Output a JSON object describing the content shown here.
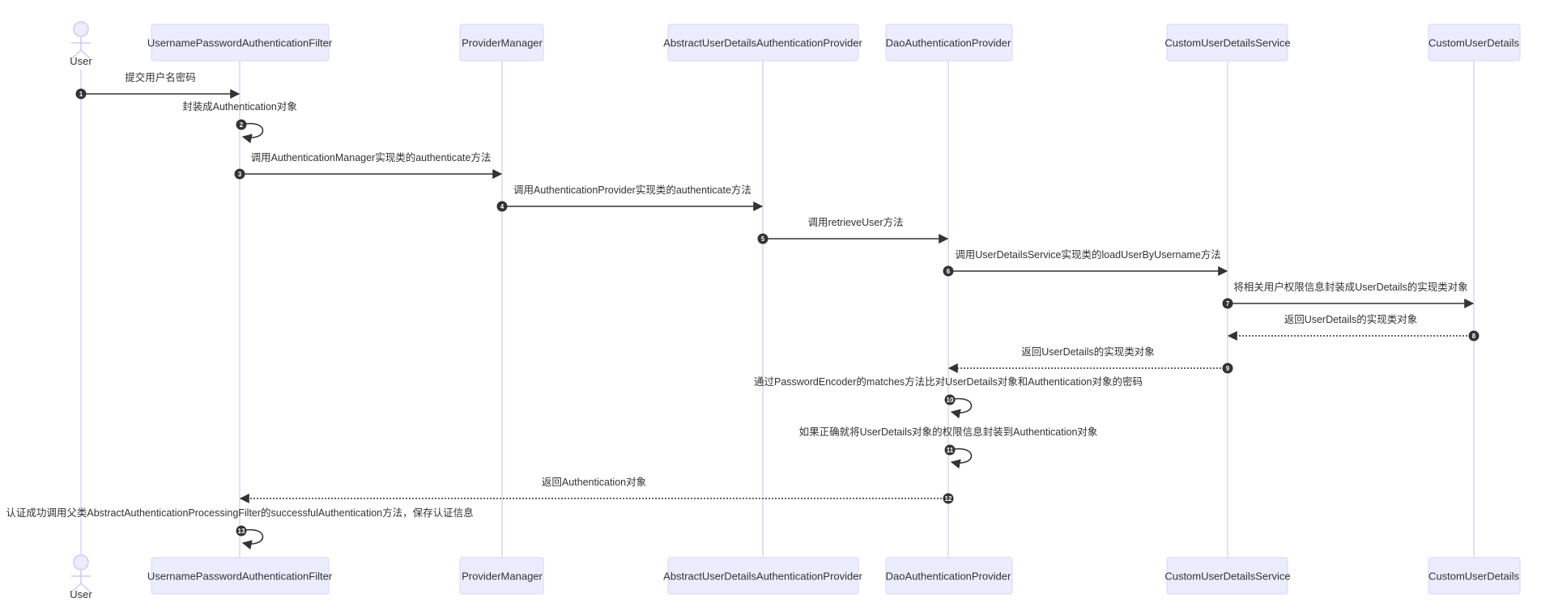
{
  "diagram": {
    "type": "sequence",
    "colors": {
      "participant_fill": "#ECECFF",
      "participant_border": "#D9D6F5",
      "line": "#333333",
      "text": "#333333"
    },
    "participants": [
      {
        "id": "User",
        "label": "User",
        "kind": "actor"
      },
      {
        "id": "UPAF",
        "label": "UsernamePasswordAuthenticationFilter",
        "kind": "participant"
      },
      {
        "id": "PM",
        "label": "ProviderManager",
        "kind": "participant"
      },
      {
        "id": "AUDAP",
        "label": "AbstractUserDetailsAuthenticationProvider",
        "kind": "participant"
      },
      {
        "id": "DAP",
        "label": "DaoAuthenticationProvider",
        "kind": "participant"
      },
      {
        "id": "CUDS",
        "label": "CustomUserDetailsService",
        "kind": "participant"
      },
      {
        "id": "CUD",
        "label": "CustomUserDetails",
        "kind": "participant"
      }
    ],
    "messages": [
      {
        "n": "1",
        "from": "User",
        "to": "UPAF",
        "label": "提交用户名密码",
        "style": "solid"
      },
      {
        "n": "2",
        "from": "UPAF",
        "to": "UPAF",
        "label": "封装成Authentication对象",
        "style": "solid"
      },
      {
        "n": "3",
        "from": "UPAF",
        "to": "PM",
        "label": "调用AuthenticationManager实现类的authenticate方法",
        "style": "solid"
      },
      {
        "n": "4",
        "from": "PM",
        "to": "AUDAP",
        "label": "调用AuthenticationProvider实现类的authenticate方法",
        "style": "solid"
      },
      {
        "n": "5",
        "from": "AUDAP",
        "to": "DAP",
        "label": "调用retrieveUser方法",
        "style": "solid"
      },
      {
        "n": "6",
        "from": "DAP",
        "to": "CUDS",
        "label": "调用UserDetailsService实现类的loadUserByUsername方法",
        "style": "solid"
      },
      {
        "n": "7",
        "from": "CUDS",
        "to": "CUD",
        "label": "将相关用户权限信息封装成UserDetails的实现类对象",
        "style": "solid"
      },
      {
        "n": "8",
        "from": "CUD",
        "to": "CUDS",
        "label": "返回UserDetails的实现类对象",
        "style": "dotted"
      },
      {
        "n": "9",
        "from": "CUDS",
        "to": "DAP",
        "label": "返回UserDetails的实现类对象",
        "style": "dotted"
      },
      {
        "n": "10",
        "from": "DAP",
        "to": "DAP",
        "label": "通过PasswordEncoder的matches方法比对UserDetails对象和Authentication对象的密码",
        "style": "solid"
      },
      {
        "n": "11",
        "from": "DAP",
        "to": "DAP",
        "label": "如果正确就将UserDetails对象的权限信息封装到Authentication对象",
        "style": "solid"
      },
      {
        "n": "12",
        "from": "DAP",
        "to": "UPAF",
        "label": "返回Authentication对象",
        "style": "dotted"
      },
      {
        "n": "13",
        "from": "UPAF",
        "to": "UPAF",
        "label": "认证成功调用父类AbstractAuthenticationProcessingFilter的successfulAuthentication方法，保存认证信息",
        "style": "solid"
      }
    ]
  }
}
